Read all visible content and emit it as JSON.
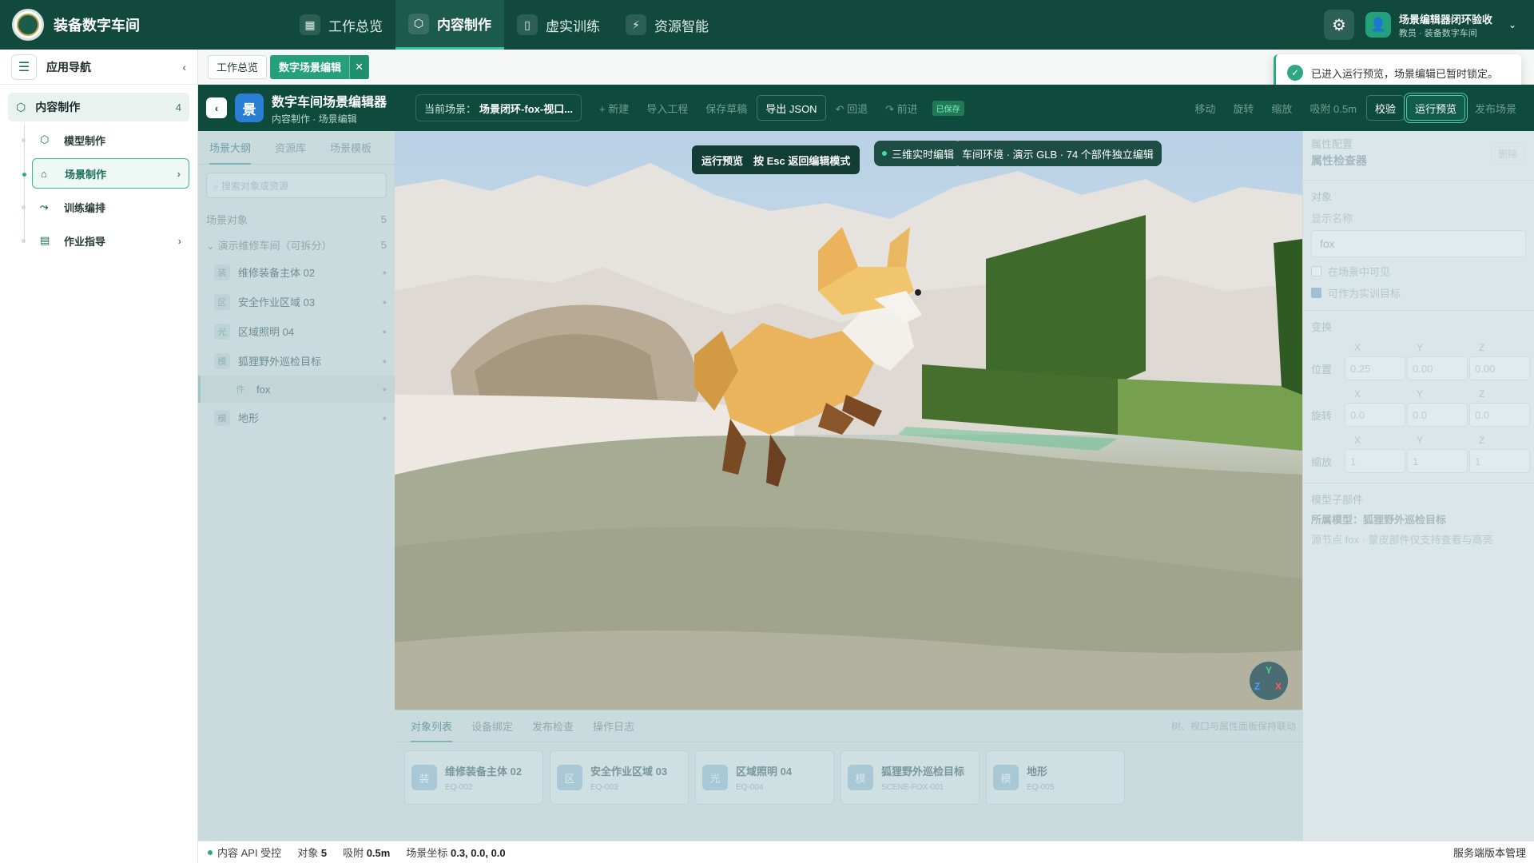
{
  "app": {
    "brand": "装备数字车间",
    "nav": [
      {
        "label": "工作总览",
        "icon": "grid-icon"
      },
      {
        "label": "内容制作",
        "icon": "cube-icon"
      },
      {
        "label": "虚实训练",
        "icon": "book-icon"
      },
      {
        "label": "资源智能",
        "icon": "plug-icon"
      }
    ],
    "user": {
      "name": "场景编辑器闭环验收",
      "role": "教员 · 装备数字车间"
    }
  },
  "sidebar": {
    "title": "应用导航",
    "group": {
      "label": "内容制作",
      "count": "4"
    },
    "items": [
      {
        "label": "模型制作"
      },
      {
        "label": "场景制作"
      },
      {
        "label": "训练编排"
      },
      {
        "label": "作业指导"
      }
    ]
  },
  "tabs": [
    {
      "label": "工作总览"
    },
    {
      "label": "数字场景编辑"
    }
  ],
  "toast": {
    "text": "已进入运行预览，场景编辑已暂时锁定。"
  },
  "editor": {
    "badge": "景",
    "title": "数字车间场景编辑器",
    "subtitle": "内容制作 · 场景编辑",
    "scene_label": "当前场景：",
    "scene_value": "场景闭环-fox-视口...",
    "toolbar": {
      "new": "+ 新建",
      "import": "导入工程",
      "save_draft": "保存草稿",
      "export_json": "导出 JSON",
      "undo": "↶ 回退",
      "redo": "↷ 前进",
      "saved": "已保存",
      "move": "移动",
      "rotate": "旋转",
      "scale": "缩放",
      "snap": "吸附 0.5m",
      "validate": "校验",
      "run_preview": "运行预览",
      "publish": "发布场景"
    }
  },
  "left_panel": {
    "tabs": [
      "场景大纲",
      "资源库",
      "场景模板"
    ],
    "search_placeholder": "⌕ 搜索对象或资源",
    "scene_objects_label": "场景对象",
    "scene_objects_count": "5",
    "group_label": "⌄ 演示维修车间（可拆分）",
    "group_count": "5",
    "objects": [
      {
        "icon": "装",
        "label": "维修装备主体 02"
      },
      {
        "icon": "区",
        "label": "安全作业区域 03"
      },
      {
        "icon": "光",
        "label": "区域照明 04"
      },
      {
        "icon": "模",
        "label": "狐狸野外巡检目标"
      },
      {
        "icon": "件",
        "label": "fox"
      },
      {
        "icon": "模",
        "label": "地形"
      }
    ]
  },
  "viewport": {
    "preview_banner": "运行预览　按 Esc 返回编辑模式",
    "mode_pill": "三维实时编辑",
    "env_pill": "车间环境 · 演示 GLB · 74 个部件独立编辑",
    "gizmo": {
      "y": "Y",
      "z": "Z",
      "x": "X"
    }
  },
  "bottom_panel": {
    "tabs": [
      "对象列表",
      "设备绑定",
      "发布检查",
      "操作日志"
    ],
    "hint": "树、视口与属性面板保持联动",
    "cards": [
      {
        "icon": "装",
        "name": "维修装备主体 02",
        "code": "EQ-002"
      },
      {
        "icon": "区",
        "name": "安全作业区域 03",
        "code": "EQ-003"
      },
      {
        "icon": "光",
        "name": "区域照明 04",
        "code": "EQ-004"
      },
      {
        "icon": "模",
        "name": "狐狸野外巡检目标",
        "code": "SCENE-FOX-001"
      },
      {
        "icon": "模",
        "name": "地形",
        "code": "EQ-005"
      }
    ]
  },
  "right_panel": {
    "h1": "属性配置",
    "h2": "属性检查器",
    "delete": "删除",
    "section_object": "对象",
    "display_name_label": "显示名称",
    "display_name_value": "fox",
    "visible_label": "在场景中可见",
    "target_label": "可作为实训目标",
    "transform_label": "变换",
    "axes": [
      "X",
      "Y",
      "Z"
    ],
    "position_label": "位置",
    "position": [
      "0.25",
      "0.00",
      "0.00"
    ],
    "rotation_label": "旋转",
    "rotation": [
      "0.0",
      "0.0",
      "0.0"
    ],
    "scale_label": "缩放",
    "scale": [
      "1",
      "1",
      "1"
    ],
    "subparts_label": "模型子部件",
    "owner": "所属模型：狐狸野外巡检目标",
    "source_note": "源节点 fox · 蒙皮部件仅支持查看与高亮"
  },
  "status": {
    "api": "内容 API 受控",
    "objects_label": "对象",
    "objects_value": "5",
    "snap_label": "吸附",
    "snap_value": "0.5m",
    "coord_label": "场景坐标",
    "coord_value": "0.3, 0.0, 0.0",
    "right": "服务端版本管理"
  }
}
